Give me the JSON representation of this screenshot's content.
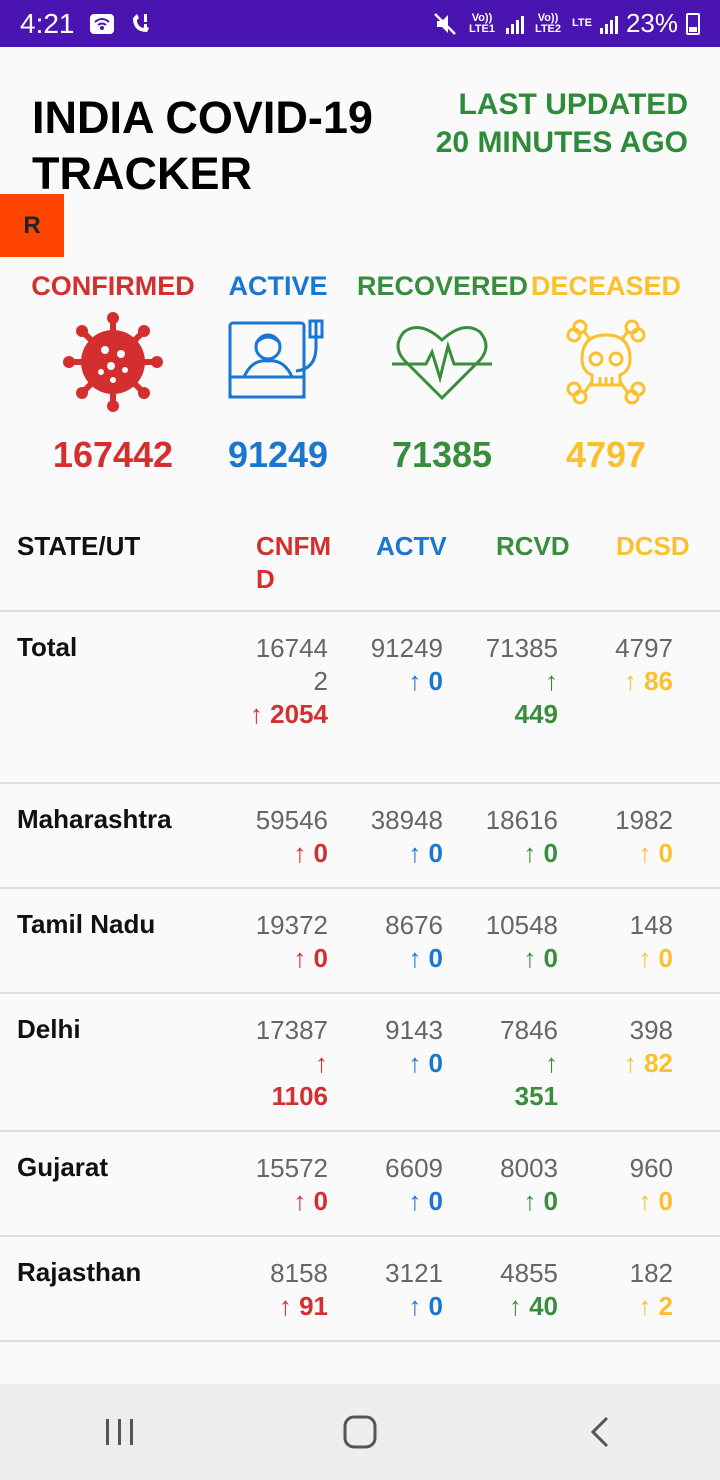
{
  "status_bar": {
    "time": "4:21",
    "sim1": "Vo)) LTE1",
    "sim2": "Vo)) LTE2",
    "lte": "LTE",
    "battery": "23%"
  },
  "header": {
    "title": "INDIA COVID-19\n TRACKER",
    "last_updated": "LAST UPDATED\n20 MINUTES AGO",
    "refresh_label": "R"
  },
  "summary": {
    "confirmed": {
      "label": "CONFIRMED",
      "value": "167442",
      "icon": "virus-icon"
    },
    "active": {
      "label": "ACTIVE",
      "value": "91249",
      "icon": "hospital-bed-icon"
    },
    "recovered": {
      "label": "RECOVERED",
      "value": "71385",
      "icon": "heartbeat-icon"
    },
    "deceased": {
      "label": "DECEASED",
      "value": "4797",
      "icon": "skull-icon"
    }
  },
  "colors": {
    "confirmed": "#d32f2f",
    "active": "#1976d2",
    "recovered": "#388e3c",
    "deceased": "#fbc02d",
    "status_bar": "#4a14b0",
    "refresh_button": "#ff4500"
  },
  "table": {
    "headers": {
      "state": "STATE/UT",
      "confirmed": "CNFMD",
      "active": "ACTV",
      "recovered": "RCVD",
      "deceased": "DCSD"
    },
    "rows": [
      {
        "state": "Total",
        "confirmed": "167442",
        "confirmed_delta": "↑ 2054",
        "active": "91249",
        "active_delta": "↑ 0",
        "recovered": "71385",
        "recovered_delta": "↑ 449",
        "deceased": "4797",
        "deceased_delta": "↑ 86"
      },
      {
        "state": "Maharashtra",
        "confirmed": "59546",
        "confirmed_delta": "↑ 0",
        "active": "38948",
        "active_delta": "↑ 0",
        "recovered": "18616",
        "recovered_delta": "↑ 0",
        "deceased": "1982",
        "deceased_delta": "↑ 0"
      },
      {
        "state": "Tamil Nadu",
        "confirmed": "19372",
        "confirmed_delta": "↑ 0",
        "active": "8676",
        "active_delta": "↑ 0",
        "recovered": "10548",
        "recovered_delta": "↑ 0",
        "deceased": "148",
        "deceased_delta": "↑ 0"
      },
      {
        "state": "Delhi",
        "confirmed": "17387",
        "confirmed_delta": "↑ 1106",
        "active": "9143",
        "active_delta": "↑ 0",
        "recovered": "7846",
        "recovered_delta": "↑ 351",
        "deceased": "398",
        "deceased_delta": "↑ 82"
      },
      {
        "state": "Gujarat",
        "confirmed": "15572",
        "confirmed_delta": "↑ 0",
        "active": "6609",
        "active_delta": "↑ 0",
        "recovered": "8003",
        "recovered_delta": "↑ 0",
        "deceased": "960",
        "deceased_delta": "↑ 0"
      },
      {
        "state": "Rajasthan",
        "confirmed": "8158",
        "confirmed_delta": "↑ 91",
        "active": "3121",
        "active_delta": "↑ 0",
        "recovered": "4855",
        "recovered_delta": "↑ 40",
        "deceased": "182",
        "deceased_delta": "↑ 2"
      }
    ]
  },
  "nav": {
    "recents": "recents-icon",
    "home": "home-icon",
    "back": "back-icon"
  }
}
